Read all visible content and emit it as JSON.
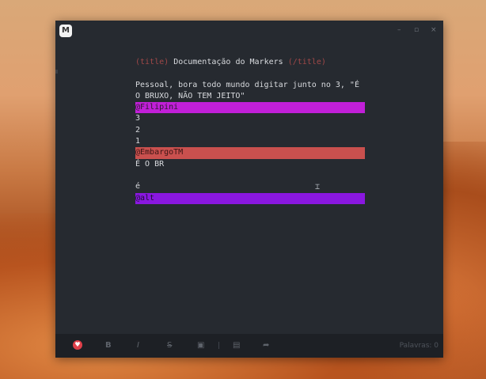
{
  "window": {
    "app_icon_glyph": "M",
    "controls": [
      "–",
      "▫",
      "×"
    ]
  },
  "document": {
    "title_open_tag": "(title)",
    "title_text": "Documentação do Markers",
    "title_close_tag": "(/title)",
    "paragraph_line1": "Pessoal, bora todo mundo digitar junto no 3, \"É",
    "paragraph_line2": "O BRUXO, NÃO TEM JEITO\"",
    "mention_filipini": "@Filipini",
    "count_3": "3",
    "count_2": "2",
    "count_1": "1",
    "mention_embargo": "@EmbargoTM",
    "line_e_o_br": "É O BR",
    "line_e": "é",
    "mention_alt": "@alt"
  },
  "highlight_colors": {
    "filipini": "#c11fd8",
    "embargo": "#c9504e",
    "alt": "#8a17e0"
  },
  "toolbar": {
    "icons": [
      "heart-icon",
      "bold-icon",
      "italic-icon",
      "strikethrough-icon",
      "image-icon",
      "book-icon",
      "share-icon"
    ],
    "bold_glyph": "B",
    "italic_glyph": "I",
    "strike_glyph": "S",
    "word_count": "Palavras: 0"
  }
}
